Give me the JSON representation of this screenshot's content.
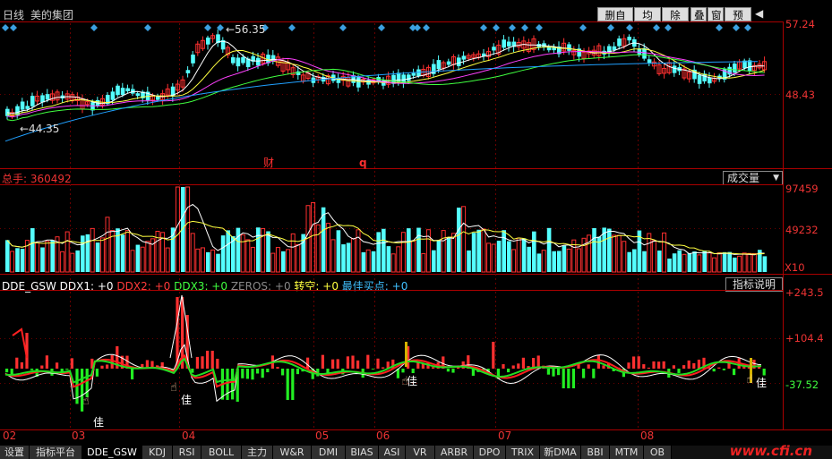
{
  "header": {
    "period": "日线",
    "stock_name": "美的集团",
    "buttons": [
      "删自选",
      "均线",
      "除权",
      "叠",
      "窗",
      "预测"
    ],
    "nav_arrow": "◀"
  },
  "price_panel": {
    "axis_top": "57.24",
    "axis_bottom": "48.43",
    "high_label": "56.35",
    "low_label": "44.35",
    "marker_cai": "财",
    "marker_q": "q",
    "diamond_color": "#3ba0e0"
  },
  "volume_panel": {
    "title": "总手: 360492",
    "dropdown": "成交量",
    "axis_top": "97459",
    "axis_mid": "49232",
    "axis_unit": "X10"
  },
  "indicator_panel": {
    "name": "DDE_GSW",
    "ddx1": "DDX1: +0",
    "ddx2": "DDX2: +0",
    "ddx3": "DDX3: +0",
    "zeros": "ZEROS: +0",
    "zhuankong": "转空: +0",
    "best_buy": "最佳买点: +0",
    "explain_button": "指标说明",
    "axis_top": "+243.5",
    "axis_mid": "+104.4",
    "axis_bottom": "-37.52",
    "marker_jia": "佳"
  },
  "months": [
    "02",
    "03",
    "04",
    "05",
    "06",
    "07",
    "08"
  ],
  "tabs": [
    "设置",
    "指标平台",
    "DDE_GSW",
    "KDJ",
    "RSI",
    "BOLL",
    "主力",
    "W&R",
    "DMI",
    "BIAS",
    "ASI",
    "VR",
    "ARBR",
    "DPO",
    "TRIX",
    "新DMA",
    "BBI",
    "MTM",
    "OB"
  ],
  "active_tab": "DDE_GSW",
  "watermark": "www.cfi.cn",
  "colors": {
    "up": "#ff3030",
    "down": "#54ffff",
    "axis_red": "#e33",
    "ma_white": "#ffffff",
    "ma_yellow": "#ffff40",
    "ma_magenta": "#ff40ff",
    "ma_green": "#40ff40",
    "ma_blue": "#20a0ff"
  }
}
